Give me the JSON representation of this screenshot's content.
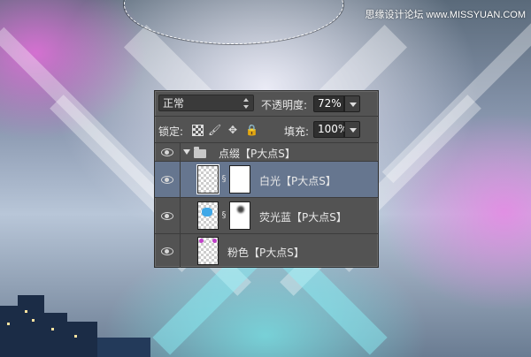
{
  "watermark": "思缘设计论坛 www.MISSYUAN.COM",
  "layers_panel": {
    "blend_mode": "正常",
    "opacity_label": "不透明度:",
    "opacity_value": "72%",
    "lock_label": "锁定:",
    "fill_label": "填充:",
    "fill_value": "100%",
    "layers": [
      {
        "name": "点缀【P大点S】",
        "type": "group"
      },
      {
        "name": "白光【P大点S】",
        "type": "layer-with-mask",
        "selected": true
      },
      {
        "name": "荧光蓝【P大点S】",
        "type": "layer-with-mask"
      },
      {
        "name": "粉色【P大点S】",
        "type": "layer"
      }
    ]
  },
  "colors": {
    "panel_bg": "#535353",
    "selected_row": "#66768f",
    "glow_pink": "#e66edc",
    "glow_cyan": "#8cf5fa"
  }
}
